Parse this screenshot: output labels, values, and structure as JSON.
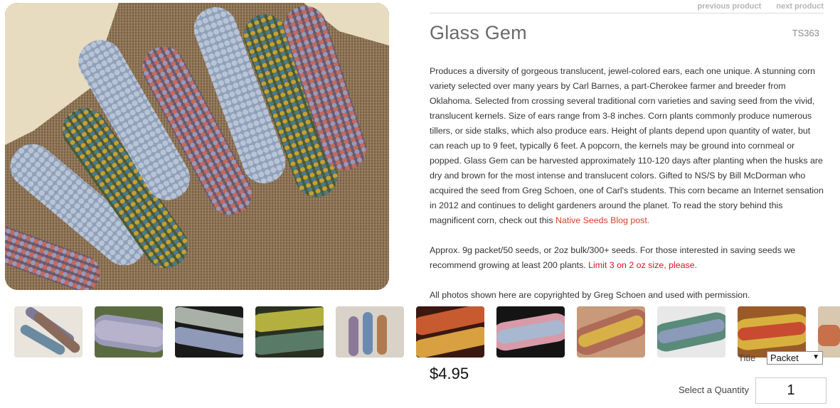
{
  "nav": {
    "previous_label": "previous product",
    "next_label": "next product"
  },
  "product": {
    "title": "Glass Gem",
    "sku": "TS363",
    "description_1": "Produces a diversity of gorgeous translucent, jewel-colored ears, each one unique. A stunning corn variety selected over many years by Carl Barnes, a part-Cherokee farmer and breeder from Oklahoma. Selected from crossing several traditional corn varieties and saving seed from the vivid, translucent kernels. Size of ears range from 3-8 inches. Corn plants commonly produce numerous tillers, or side stalks, which also produce ears. Height of plants depend upon quantity of water, but can reach up to 9 feet, typically 6 feet. A popcorn, the kernels may be ground into cornmeal or popped. Glass Gem can be harvested approximately 110-120 days after planting when the husks are dry and brown for the most intense and translucent colors. Gifted to NS/S by Bill McDorman who acquired the seed from Greg Schoen, one of Carl's students. This corn became an Internet sensation in 2012 and continues to delight gardeners around the planet. To read the story behind this magnificent corn, check out this ",
    "blog_link": "Native Seeds Blog post.",
    "description_2": "Approx. 9g packet/50 seeds, or  2oz bulk/300+ seeds.  For those interested in saving seeds we recommend growing at least 200 plants. ",
    "limit_note": "Limit 3 on 2 oz size, please.",
    "description_3": "All photos shown here are copyrighted by Greg Schoen and used with permission.",
    "price": "$4.95"
  },
  "purchase": {
    "title_label": "Title",
    "variant_selected": "Packet",
    "quantity_label": "Select a Quantity",
    "quantity_value": "1"
  },
  "colors": {
    "link": "#d5402b",
    "limit": "#d8102a",
    "title": "#6a6a6a"
  }
}
